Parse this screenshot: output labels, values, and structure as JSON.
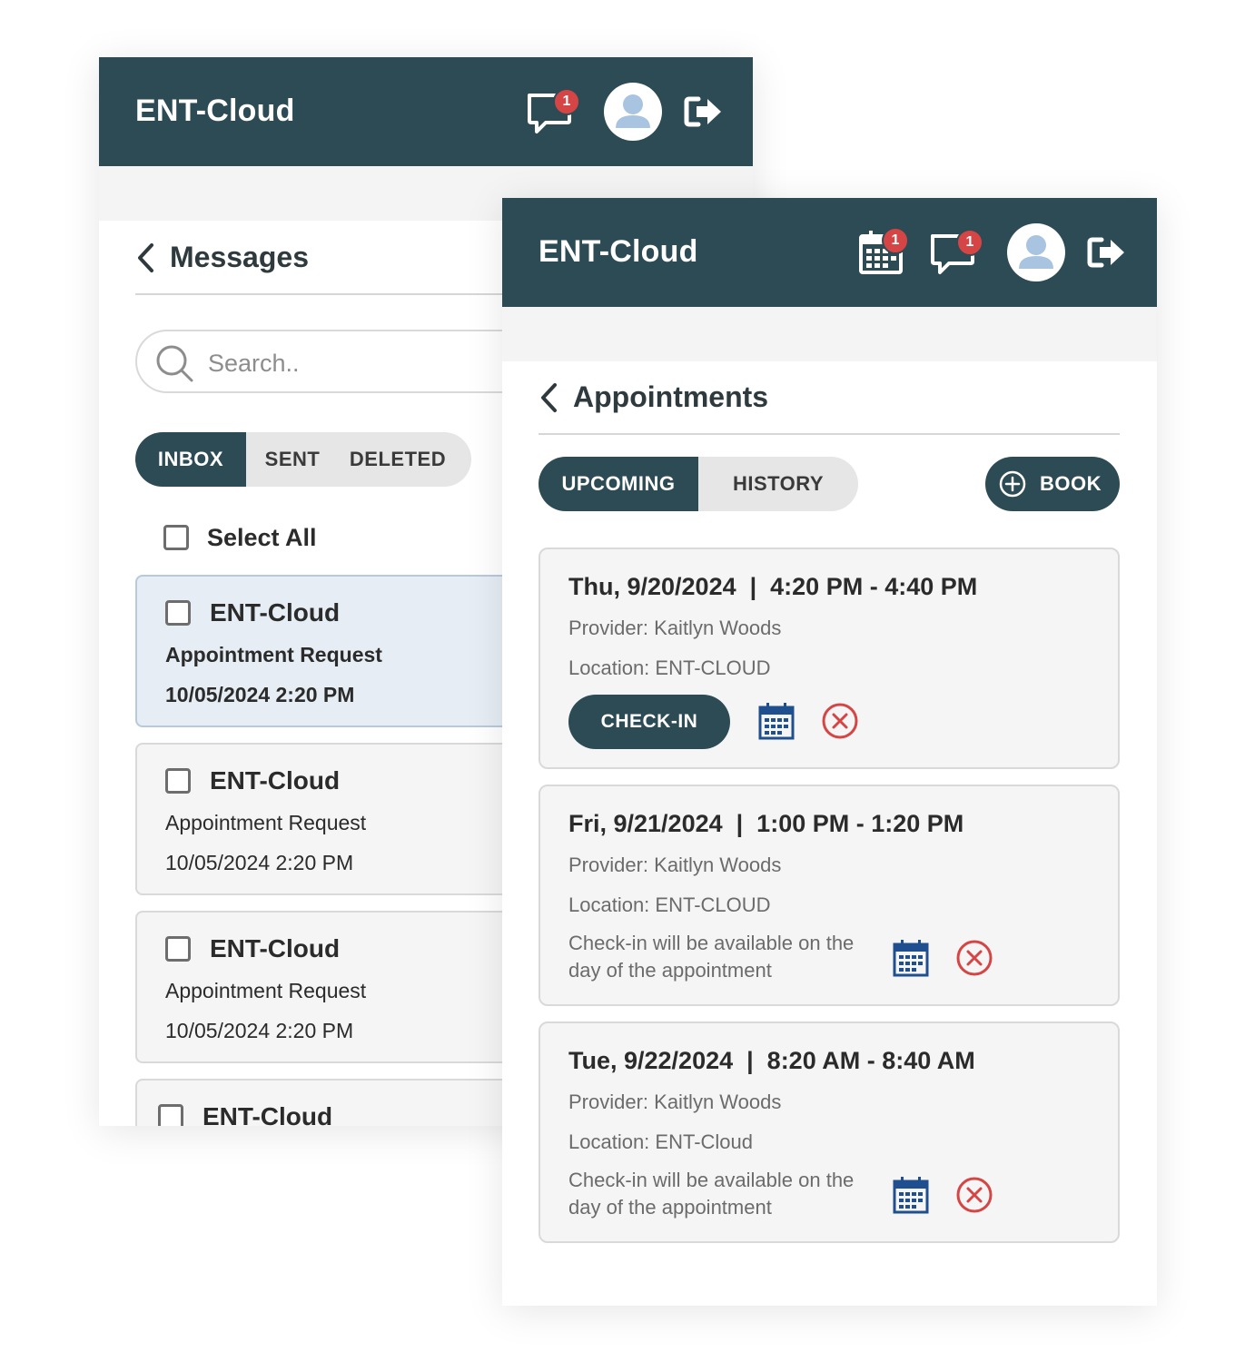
{
  "messages_screen": {
    "app_title": "ENT-Cloud",
    "chat_badge": "1",
    "page_title": "Messages",
    "search": {
      "placeholder": "Search.."
    },
    "tabs": [
      {
        "label": "INBOX",
        "active": true
      },
      {
        "label": "SENT",
        "active": false
      },
      {
        "label": "DELETED",
        "active": false
      }
    ],
    "select_all_label": "Select All",
    "messages": [
      {
        "sender": "ENT-Cloud",
        "subject": "Appointment Request",
        "date": "10/05/2024 2:20 PM",
        "unread": true,
        "selected": true
      },
      {
        "sender": "ENT-Cloud",
        "subject": "Appointment Request",
        "date": "10/05/2024 2:20 PM",
        "unread": false,
        "selected": false
      },
      {
        "sender": "ENT-Cloud",
        "subject": "Appointment Request",
        "date": "10/05/2024 2:20 PM",
        "unread": false,
        "selected": false
      },
      {
        "sender": "ENT-Cloud"
      }
    ]
  },
  "appointments_screen": {
    "app_title": "ENT-Cloud",
    "calendar_badge": "1",
    "chat_badge": "1",
    "page_title": "Appointments",
    "tabs": [
      {
        "label": "UPCOMING",
        "active": true
      },
      {
        "label": "HISTORY",
        "active": false
      }
    ],
    "book_label": "BOOK",
    "appointments": [
      {
        "when": "Thu, 9/20/2024  |  4:20 PM - 4:40 PM",
        "provider": "Provider: Kaitlyn Woods",
        "location": "Location: ENT-CLOUD",
        "checkin_label": "CHECK-IN"
      },
      {
        "when": "Fri, 9/21/2024  |  1:00 PM - 1:20 PM",
        "provider": "Provider: Kaitlyn Woods",
        "location": "Location: ENT-CLOUD",
        "note": "Check-in will be available on the day of the appointment"
      },
      {
        "when": "Tue, 9/22/2024  |  8:20 AM - 8:40 AM",
        "provider": "Provider: Kaitlyn Woods",
        "location": "Location: ENT-Cloud",
        "note": "Check-in will be available on the day of the appointment"
      }
    ]
  },
  "colors": {
    "header": "#2d4b54",
    "badge": "#d64545",
    "calendar_icon": "#1f4f8f",
    "cancel_icon": "#d64545",
    "selected_row": "#e6edf4"
  },
  "icons": [
    "chat-icon",
    "avatar-icon",
    "logout-icon",
    "calendar-icon",
    "search-icon",
    "back-chevron-icon",
    "add-circle-icon",
    "cancel-icon"
  ]
}
